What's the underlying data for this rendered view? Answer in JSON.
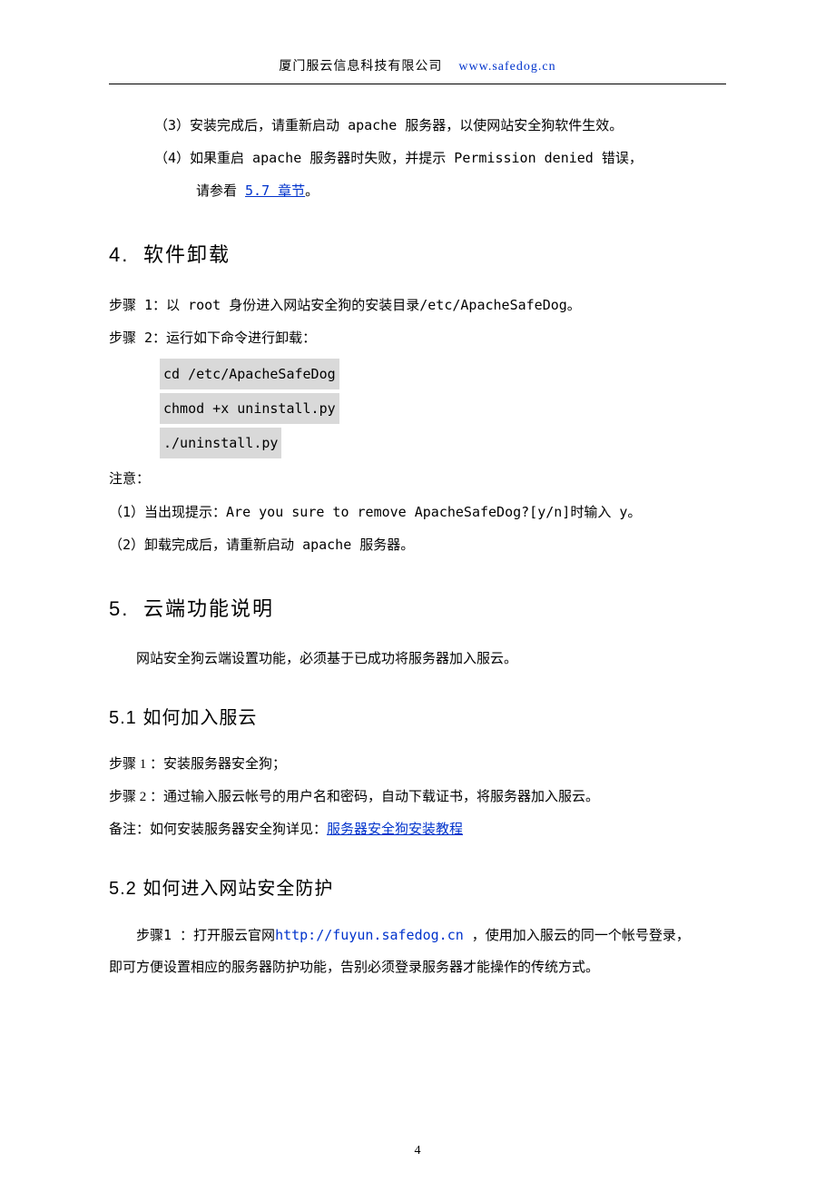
{
  "header": {
    "company": "厦门服云信息科技有限公司",
    "url": "www.safedog.cn"
  },
  "section3_tail": {
    "item3": "（3）安装完成后，请重新启动 apache 服务器，以使网站安全狗软件生效。",
    "item4_a": "（4）如果重启 apache 服务器时失败，并提示 Permission denied 错误，",
    "item4_b_prefix": "请参看 ",
    "item4_b_link": "5.7 章节",
    "item4_b_suffix": "。"
  },
  "section4": {
    "title_num": "4.",
    "title_text": "软件卸载",
    "step1": "步骤 1：以 root 身份进入网站安全狗的安装目录/etc/ApacheSafeDog。",
    "step2": "步骤 2：运行如下命令进行卸载：",
    "code": [
      "cd /etc/ApacheSafeDog",
      "chmod +x uninstall.py",
      "./uninstall.py"
    ],
    "note_label": "注意：",
    "note1": "（1）当出现提示：Are you sure to remove ApacheSafeDog?[y/n]时输入 y。",
    "note2": "（2）卸载完成后，请重新启动 apache 服务器。"
  },
  "section5": {
    "title_num": "5.",
    "title_text": "云端功能说明",
    "intro": "网站安全狗云端设置功能，必须基于已成功将服务器加入服云。"
  },
  "section5_1": {
    "title": "5.1 如何加入服云",
    "step1": "步骤 1 ：安装服务器安全狗；",
    "step2": "步骤 2 ：通过输入服云帐号的用户名和密码，自动下载证书，将服务器加入服云。",
    "remark_prefix": "备注：如何安装服务器安全狗详见：",
    "remark_link": "服务器安全狗安装教程"
  },
  "section5_2": {
    "title": "5.2 如何进入网站安全防护",
    "p1_a": "步骤1 ：打开服云官网",
    "p1_link": "http://fuyun.safedog.cn",
    "p1_b": " ，使用加入服云的同一个帐号登录，",
    "p2": "即可方便设置相应的服务器防护功能，告别必须登录服务器才能操作的传统方式。"
  },
  "page_number": "4"
}
